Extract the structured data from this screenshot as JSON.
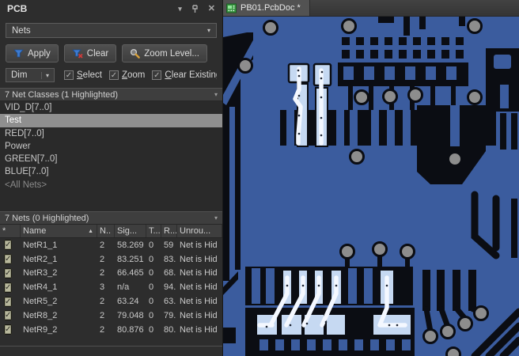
{
  "panel": {
    "title": "PCB",
    "selector_value": "Nets",
    "buttons": {
      "apply": "Apply",
      "clear": "Clear",
      "zoom_level": "Zoom Level..."
    },
    "dim_value": "Dim",
    "options": [
      {
        "label": "Select",
        "checked": true
      },
      {
        "label": "Zoom",
        "checked": true
      },
      {
        "label": "Clear Existing",
        "checked": true
      }
    ],
    "classes_section": {
      "header": "7 Net Classes (1 Highlighted)",
      "items": [
        {
          "label": "VID_D[7..0]",
          "selected": false
        },
        {
          "label": "Test",
          "selected": true
        },
        {
          "label": "RED[7..0]",
          "selected": false
        },
        {
          "label": "Power",
          "selected": false
        },
        {
          "label": "GREEN[7..0]",
          "selected": false
        },
        {
          "label": "BLUE[7..0]",
          "selected": false
        },
        {
          "label": "<All Nets>",
          "selected": false,
          "muted": true
        }
      ]
    },
    "nets_section": {
      "header": "7 Nets (0 Highlighted)",
      "columns": [
        "*",
        "Name",
        "N..",
        "Sig...",
        "T...",
        "R...",
        "Unrou..."
      ],
      "rows": [
        {
          "checked": true,
          "name": "NetR1_1",
          "n": "2",
          "sig": "58.269",
          "t": "0",
          "r": "59",
          "unrouted": "Net is Hid"
        },
        {
          "checked": true,
          "name": "NetR2_1",
          "n": "2",
          "sig": "83.251",
          "t": "0",
          "r": "83.",
          "unrouted": "Net is Hid"
        },
        {
          "checked": true,
          "name": "NetR3_2",
          "n": "2",
          "sig": "66.465",
          "t": "0",
          "r": "68.",
          "unrouted": "Net is Hid"
        },
        {
          "checked": true,
          "name": "NetR4_1",
          "n": "3",
          "sig": "n/a",
          "t": "0",
          "r": "94.",
          "unrouted": "Net is Hid"
        },
        {
          "checked": true,
          "name": "NetR5_2",
          "n": "2",
          "sig": "63.24",
          "t": "0",
          "r": "63.",
          "unrouted": "Net is Hid"
        },
        {
          "checked": true,
          "name": "NetR8_2",
          "n": "2",
          "sig": "79.048",
          "t": "0",
          "r": "79.",
          "unrouted": "Net is Hid"
        },
        {
          "checked": true,
          "name": "NetR9_2",
          "n": "2",
          "sig": "80.876",
          "t": "0",
          "r": "80.",
          "unrouted": "Net is Hid"
        }
      ]
    }
  },
  "editor": {
    "tab_label": "PB01.PcbDoc *"
  },
  "icons": {
    "collapse_arrow": "▾",
    "close": "✕",
    "combo_arrow": "▾",
    "sort_ascending": "▲",
    "check": "✓"
  },
  "colors": {
    "copper_dimmed": "#3b5c9e",
    "board_background": "#0b0d13",
    "via": "#8d8d8d",
    "highlighted_pad": "#c6d9f2",
    "highlighted_track": "#f4f8ff",
    "selected_row": "#8f8f8f"
  }
}
